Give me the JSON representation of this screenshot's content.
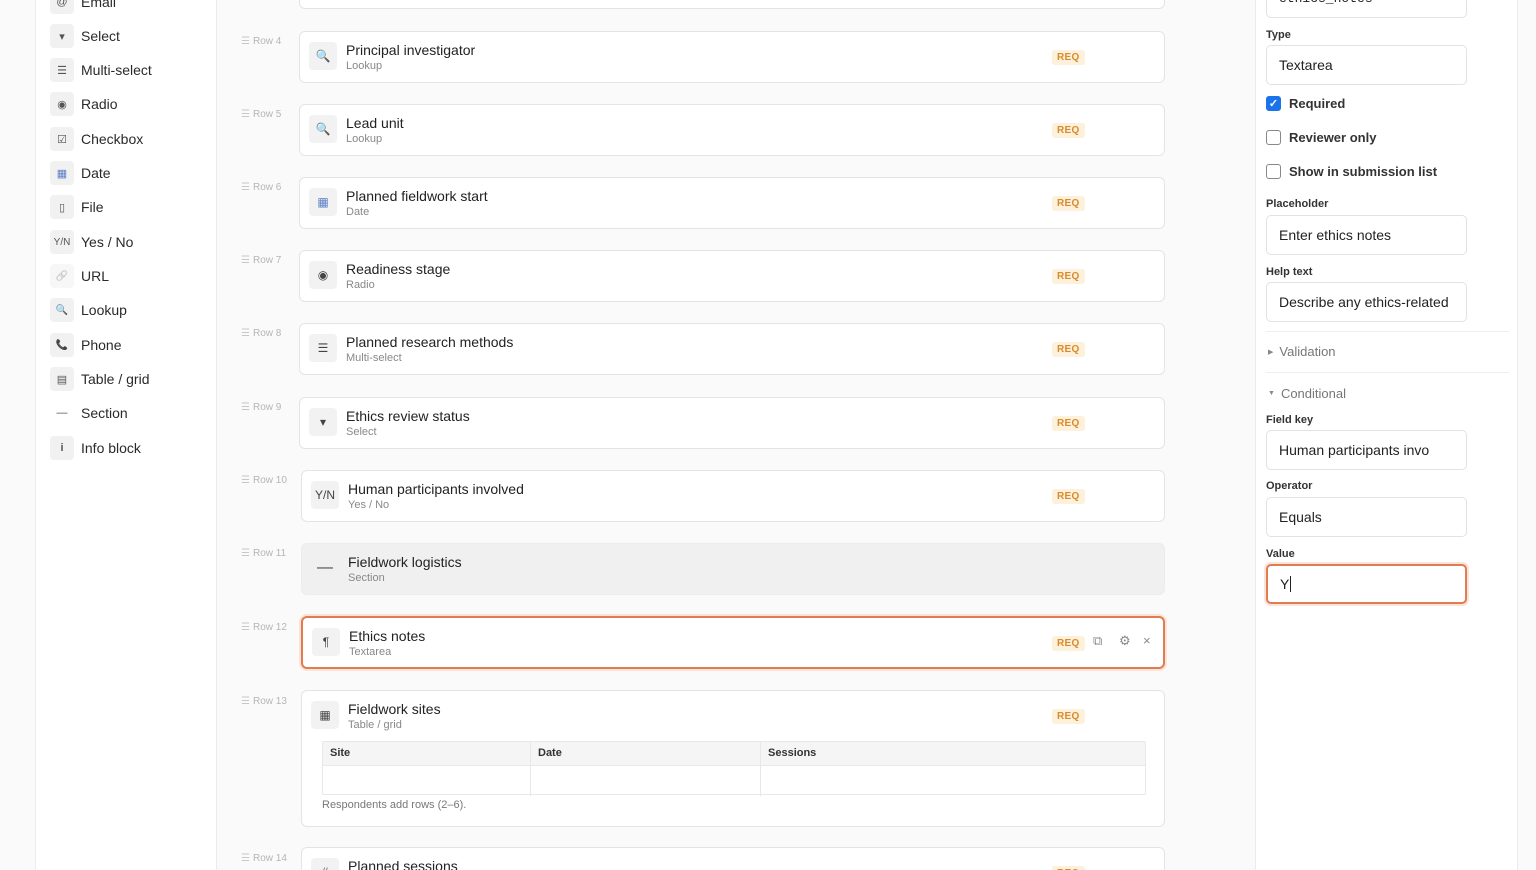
{
  "palette": {
    "items": [
      {
        "icon": "@",
        "label": "Email"
      },
      {
        "icon": "▾",
        "label": "Select"
      },
      {
        "icon": "☰",
        "label": "Multi-select"
      },
      {
        "icon": "◉",
        "label": "Radio"
      },
      {
        "icon": "☑",
        "label": "Checkbox"
      },
      {
        "icon": "▦",
        "label": "Date"
      },
      {
        "icon": "▯",
        "label": "File"
      },
      {
        "icon": "Y/N",
        "label": "Yes / No"
      },
      {
        "icon": "🔗",
        "label": "URL"
      },
      {
        "icon": "🔍",
        "label": "Lookup"
      },
      {
        "icon": "📞",
        "label": "Phone"
      },
      {
        "icon": "▤",
        "label": "Table / grid"
      },
      {
        "icon": "—",
        "label": "Section"
      },
      {
        "icon": "i",
        "label": "Info block"
      }
    ]
  },
  "canvas": {
    "req_badge": "REQ",
    "rows": [
      {
        "row": "Row 4",
        "icon": "🔍",
        "title": "Principal investigator",
        "type": "Lookup"
      },
      {
        "row": "Row 5",
        "icon": "🔍",
        "title": "Lead unit",
        "type": "Lookup"
      },
      {
        "row": "Row 6",
        "icon": "▦",
        "title": "Planned fieldwork start",
        "type": "Date"
      },
      {
        "row": "Row 7",
        "icon": "◉",
        "title": "Readiness stage",
        "type": "Radio"
      },
      {
        "row": "Row 8",
        "icon": "☰",
        "title": "Planned research methods",
        "type": "Multi-select"
      },
      {
        "row": "Row 9",
        "icon": "▾",
        "title": "Ethics review status",
        "type": "Select"
      },
      {
        "row": "Row 10",
        "icon": "Y/N",
        "title": "Human participants involved",
        "type": "Yes / No"
      },
      {
        "row": "Row 11",
        "icon": "—",
        "title": "Fieldwork logistics",
        "type": "Section"
      },
      {
        "row": "Row 12",
        "icon": "¶",
        "title": "Ethics notes",
        "type": "Textarea"
      },
      {
        "row": "Row 13",
        "icon": "▦",
        "title": "Fieldwork sites",
        "type": "Table / grid"
      },
      {
        "row": "Row 14",
        "icon": "#",
        "title": "Planned sessions",
        "type": ""
      }
    ],
    "grid": {
      "columns": [
        "Site",
        "Date",
        "Sessions"
      ],
      "note": "Respondents add rows (2–6)."
    },
    "actions": {
      "duplicate": "⧉",
      "settings": "⚙",
      "remove": "×"
    }
  },
  "inspector": {
    "key_value": "ethics_notes",
    "type_label": "Type",
    "type_value": "Textarea",
    "required_label": "Required",
    "reviewer_label": "Reviewer only",
    "show_list_label": "Show in submission list",
    "placeholder_label": "Placeholder",
    "placeholder_value": "Enter ethics notes",
    "help_label": "Help text",
    "help_value": "Describe any ethics-related",
    "validation_label": "Validation",
    "conditional_label": "Conditional",
    "field_key_label": "Field key",
    "field_key_value": "Human participants invo",
    "operator_label": "Operator",
    "operator_value": "Equals",
    "value_label": "Value",
    "value_value": "Y"
  },
  "colors": {
    "accent": "#e07c52",
    "req": "#d98a2b",
    "check": "#1a73e8"
  }
}
